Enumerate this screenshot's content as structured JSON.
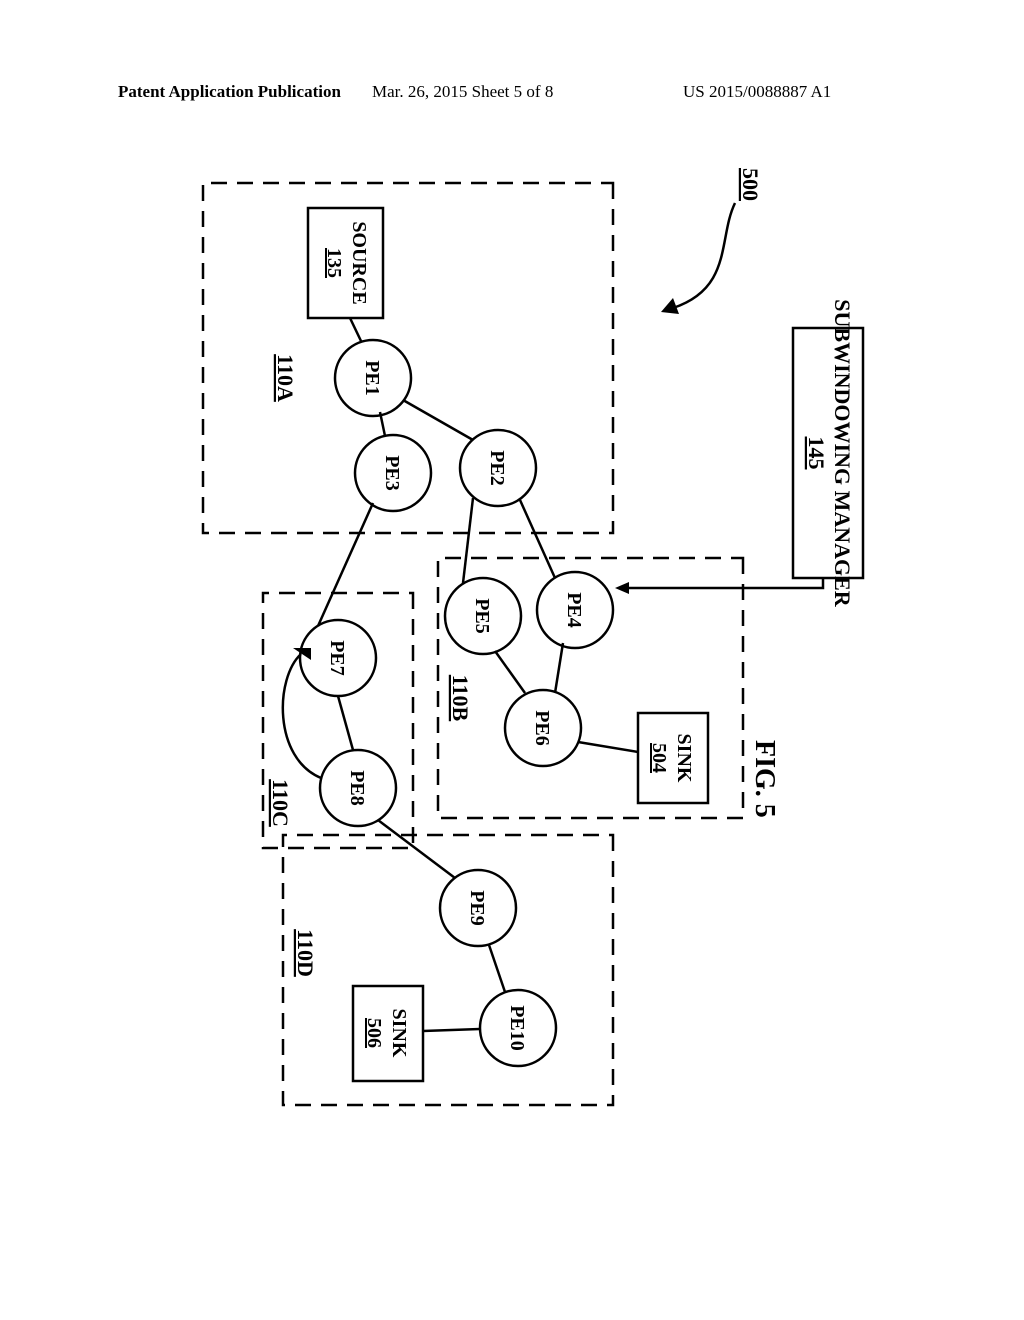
{
  "header": {
    "left": "Patent Application Publication",
    "center": "Mar. 26, 2015  Sheet 5 of 8",
    "right": "US 2015/0088887 A1"
  },
  "diagram": {
    "num": "500",
    "manager_label": "SUBWINDOWING MANAGER",
    "manager_ref": "145",
    "nodes": {
      "source": {
        "label": "SOURCE",
        "ref": "135"
      },
      "pe1": "PE1",
      "pe2": "PE2",
      "pe3": "PE3",
      "pe4": "PE4",
      "pe5": "PE5",
      "pe6": "PE6",
      "pe7": "PE7",
      "pe8": "PE8",
      "pe9": "PE9",
      "pe10": "PE10",
      "sink504": {
        "label": "SINK",
        "ref": "504"
      },
      "sink506": {
        "label": "SINK",
        "ref": "506"
      }
    },
    "groups": {
      "a": "110A",
      "b": "110B",
      "c": "110C",
      "d": "110D"
    }
  },
  "figure_label": "FIG. 5"
}
